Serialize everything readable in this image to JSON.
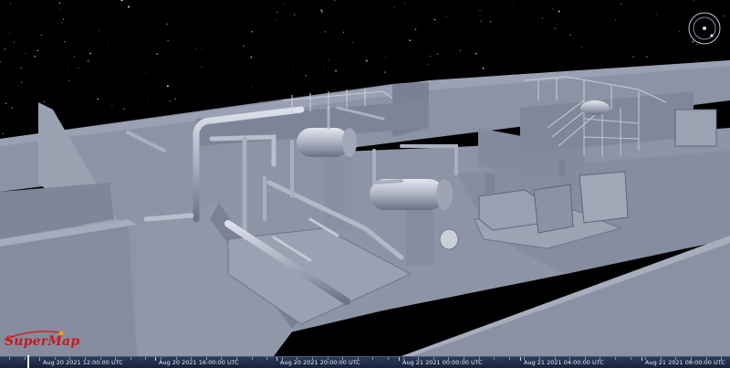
{
  "app": {
    "logo_text": "SuperMap"
  },
  "compass": {
    "icon": "compass-icon"
  },
  "timeline": {
    "ticks": [
      {
        "label": "Aug 20 2021 12:00:00 UTC"
      },
      {
        "label": "Aug 20 2021 16:00:00 UTC"
      },
      {
        "label": "Aug 20 2021 20:00:00 UTC"
      },
      {
        "label": "Aug 21 2021 00:00:00 UTC"
      },
      {
        "label": "Aug 21 2021 04:00:00 UTC"
      },
      {
        "label": "Aug 21 2021 08:00:00 UTC"
      }
    ]
  },
  "colors": {
    "sky": "#000000",
    "model_gray": "#8a92a6",
    "logo_red": "#c81a1a",
    "timeline_bg": "#1e2c48"
  }
}
